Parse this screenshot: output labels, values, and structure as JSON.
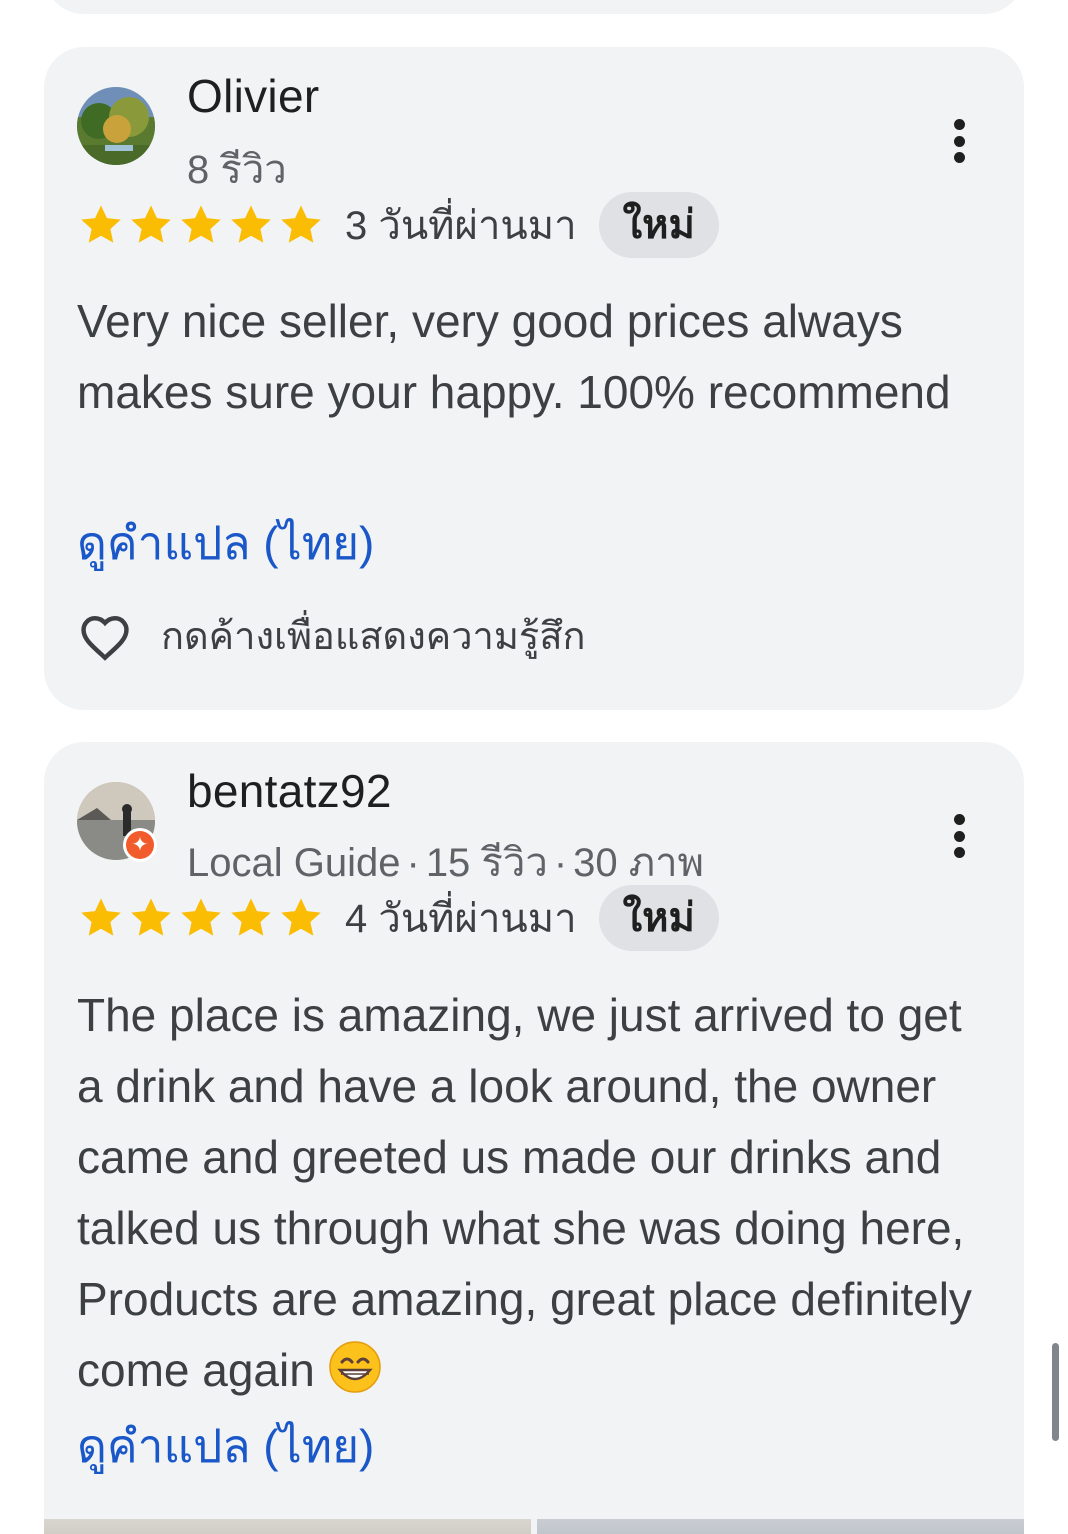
{
  "reviews": [
    {
      "author": "Olivier",
      "meta": "8 รีวิว",
      "rating": 5,
      "time": "3 วันที่ผ่านมา",
      "badge": "ใหม่",
      "text": "Very nice seller, very good prices always makes sure your happy. 100% recommend",
      "translate": "ดูคำแปล (ไทย)",
      "react_label": "กดค้างเพื่อแสดงความรู้สึก"
    },
    {
      "author": "bentatz92",
      "local_guide": "Local Guide",
      "review_count": "15 รีวิว",
      "photo_count": "30 ภาพ",
      "rating": 5,
      "time": "4 วันที่ผ่านมา",
      "badge": "ใหม่",
      "text": "The place is amazing, we just arrived to get a drink and have a look around, the owner came and greeted us made our drinks and talked us through what she was doing here, Products are amazing, great place definitely come again",
      "translate": "ดูคำแปล (ไทย)"
    }
  ],
  "separator": "·",
  "icons": {
    "star": "star-icon",
    "more": "more-vert-icon",
    "heart": "heart-outline-icon",
    "local_guide": "local-guide-badge-icon",
    "emoji": "grinning-face-emoji"
  },
  "colors": {
    "star": "#fbbc04",
    "link": "#1a57c8",
    "card": "#f1f3f4",
    "badge_bg": "#dfe1e5",
    "local_guide_badge": "#f25c2d"
  }
}
